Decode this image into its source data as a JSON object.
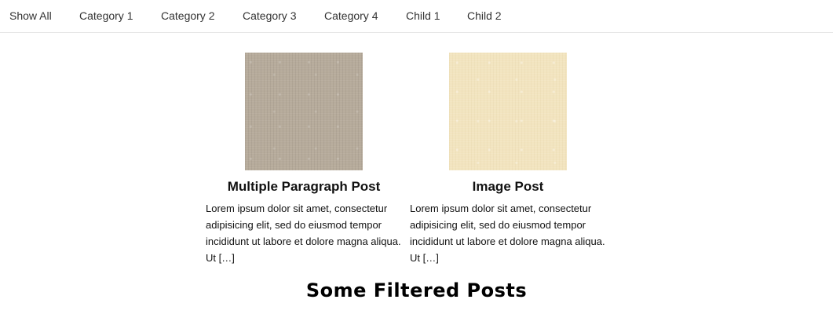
{
  "filter_tabs": [
    {
      "label": "Show All"
    },
    {
      "label": "Category 1"
    },
    {
      "label": "Category 2"
    },
    {
      "label": "Category 3"
    },
    {
      "label": "Category 4"
    },
    {
      "label": "Child 1"
    },
    {
      "label": "Child 2"
    }
  ],
  "posts": [
    {
      "title": "Multiple Paragraph Post",
      "excerpt": "Lorem ipsum dolor sit amet, consectetur adipisicing elit, sed do eiusmod tempor incididunt ut labore et dolore magna aliqua. Ut […]",
      "thumbnail_color": "#b6ab9b"
    },
    {
      "title": "Image Post",
      "excerpt": "Lorem ipsum dolor sit amet, consectetur adipisicing elit, sed do eiusmod tempor incididunt ut labore et dolore magna aliqua. Ut […]",
      "thumbnail_color": "#f2e4bf"
    }
  ],
  "section_heading": "Some Filtered Posts"
}
